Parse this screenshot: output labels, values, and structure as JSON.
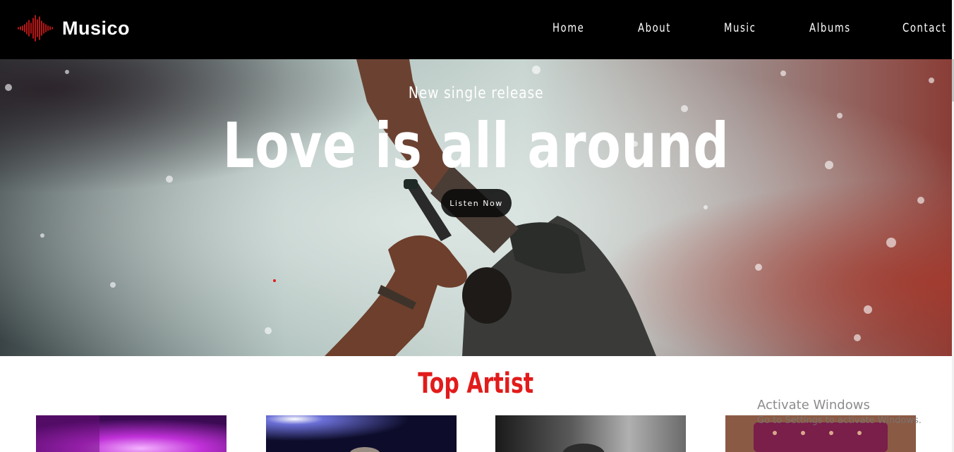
{
  "brand": {
    "name": "Musico",
    "logo_icon": "sound-wave-icon",
    "logo_color": "#e21b1b"
  },
  "nav": {
    "items": [
      {
        "label": "Home"
      },
      {
        "label": "About"
      },
      {
        "label": "Music"
      },
      {
        "label": "Albums"
      },
      {
        "label": "Contact"
      }
    ]
  },
  "hero": {
    "subtitle": "New single release",
    "title": "Love is all around",
    "button_label": "Listen Now"
  },
  "artists_section": {
    "title": "Top Artist",
    "title_color": "#e21b1b"
  },
  "windows_watermark": {
    "title": "Activate Windows",
    "subtitle": "Go to Settings to activate Windows."
  }
}
